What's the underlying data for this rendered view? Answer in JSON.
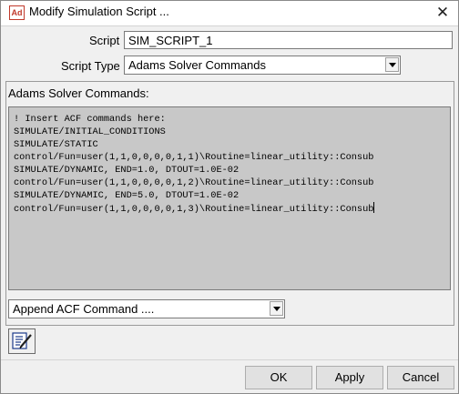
{
  "window": {
    "app_badge": "Ad",
    "title": "Modify Simulation Script ...",
    "close_glyph": "✕"
  },
  "form": {
    "script_label": "Script",
    "script_value": "SIM_SCRIPT_1",
    "type_label": "Script Type",
    "type_value": "Adams Solver Commands"
  },
  "commands": {
    "group_label": "Adams Solver Commands:",
    "lines": [
      "! Insert ACF commands here:",
      "SIMULATE/INITIAL_CONDITIONS",
      "SIMULATE/STATIC",
      "control/Fun=user(1,1,0,0,0,0,1,1)\\Routine=linear_utility::Consub",
      "SIMULATE/DYNAMIC, END=1.0, DTOUT=1.0E-02",
      "control/Fun=user(1,1,0,0,0,0,1,2)\\Routine=linear_utility::Consub",
      "SIMULATE/DYNAMIC, END=5.0, DTOUT=1.0E-02",
      "control/Fun=user(1,1,0,0,0,0,1,3)\\Routine=linear_utility::Consub"
    ],
    "append_value": "Append ACF Command ....",
    "tool_icon": "edit-text-icon"
  },
  "buttons": {
    "ok": "OK",
    "apply": "Apply",
    "cancel": "Cancel"
  },
  "colors": {
    "editor_bg": "#c8c8c8",
    "badge_red": "#c0392b"
  }
}
